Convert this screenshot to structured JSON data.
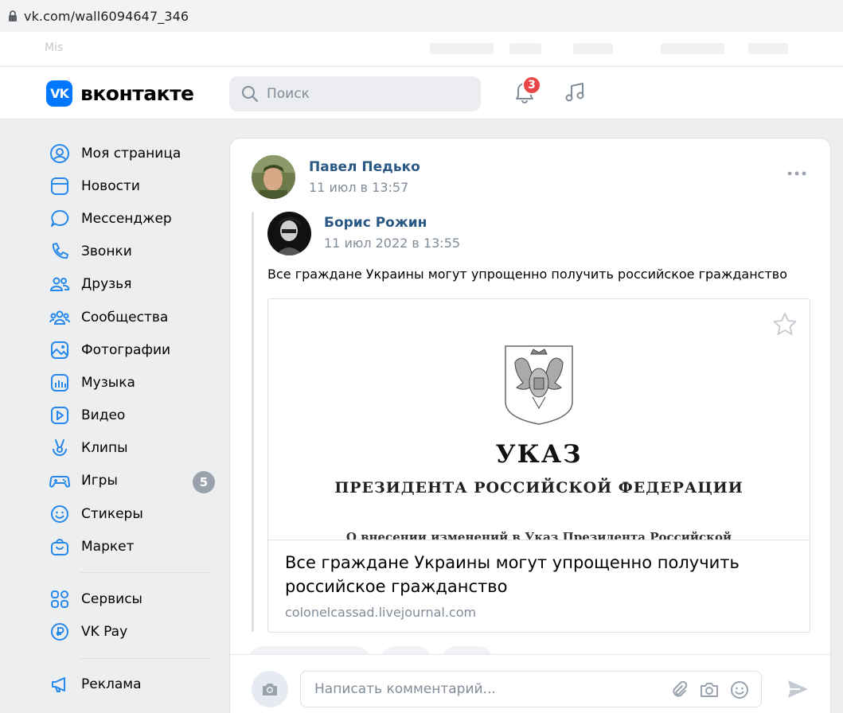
{
  "browser": {
    "url": "vk.com/wall6094647_346",
    "bookmark_label": "Mis"
  },
  "header": {
    "logo_text": "вконтакте",
    "logo_mark": "VK",
    "search_placeholder": "Поиск",
    "notifications_count": "3"
  },
  "sidebar": {
    "items": [
      {
        "label": "Моя страница",
        "icon": "user-circle-icon"
      },
      {
        "label": "Новости",
        "icon": "newsfeed-icon"
      },
      {
        "label": "Мессенджер",
        "icon": "message-icon"
      },
      {
        "label": "Звонки",
        "icon": "phone-icon"
      },
      {
        "label": "Друзья",
        "icon": "friends-icon"
      },
      {
        "label": "Сообщества",
        "icon": "communities-icon"
      },
      {
        "label": "Фотографии",
        "icon": "photo-icon"
      },
      {
        "label": "Музыка",
        "icon": "music-icon"
      },
      {
        "label": "Видео",
        "icon": "video-icon"
      },
      {
        "label": "Клипы",
        "icon": "clips-icon"
      },
      {
        "label": "Игры",
        "icon": "gamepad-icon",
        "count": "5"
      },
      {
        "label": "Стикеры",
        "icon": "smile-icon"
      },
      {
        "label": "Маркет",
        "icon": "market-icon"
      }
    ],
    "secondary": [
      {
        "label": "Сервисы",
        "icon": "services-icon"
      },
      {
        "label": "VK Pay",
        "icon": "vkpay-icon"
      }
    ],
    "tertiary": [
      {
        "label": "Реклама",
        "icon": "megaphone-icon"
      }
    ]
  },
  "post": {
    "author": "Павел Педько",
    "time": "11 июл в 13:57",
    "repost": {
      "author": "Борис Рожин",
      "time": "11 июл 2022 в 13:55",
      "text": "Все граждане Украины могут упрощенно получить российское гражданство",
      "link": {
        "image_title": "УКАЗ",
        "image_subtitle": "ПРЕЗИДЕНТА РОССИЙСКОЙ ФЕДЕРАЦИИ",
        "image_line": "О внесении изменений в Указ Президента Российской",
        "title": "Все граждане Украины могут упрощенно получить российское гражданство",
        "domain": "colonelcassad.livejournal.com"
      }
    }
  },
  "comment": {
    "placeholder": "Написать комментарий..."
  },
  "colors": {
    "accent": "#0077ff",
    "link": "#2a5885",
    "badge": "#e64646",
    "muted": "#818c99",
    "background": "#edeef0"
  }
}
